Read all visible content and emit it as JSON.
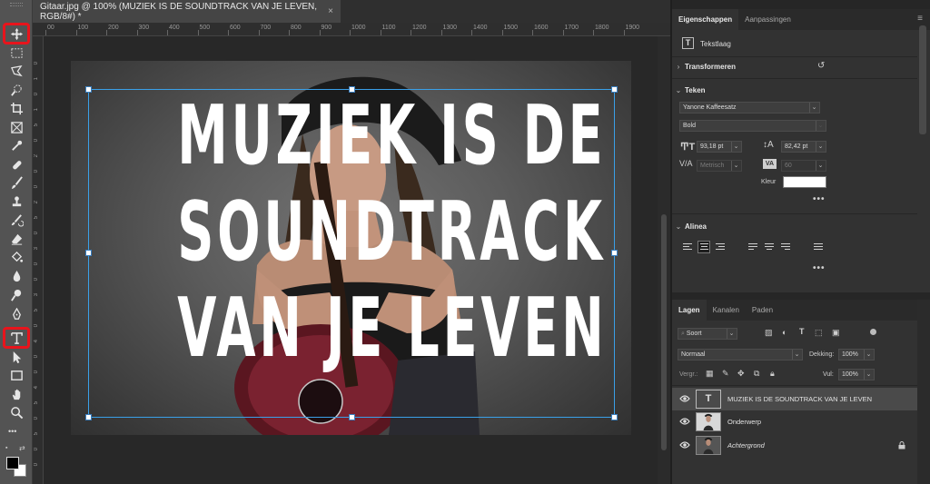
{
  "document": {
    "tab_title": "Gitaar.jpg @ 100% (MUZIEK IS DE SOUNDTRACK VAN JE LEVEN, RGB/8#) *",
    "close_glyph": "×",
    "ruler_top": [
      "00",
      "100",
      "200",
      "300",
      "400",
      "500",
      "600",
      "700",
      "800",
      "900",
      "1000",
      "1100",
      "1200",
      "1300",
      "1400",
      "1500",
      "1600",
      "1700",
      "1800",
      "1900"
    ],
    "ruler_left": [
      "0",
      "1",
      "0",
      "1",
      "5",
      "0",
      "2",
      "0",
      "0",
      "2",
      "5",
      "0",
      "3",
      "0",
      "0",
      "3",
      "5",
      "0",
      "4",
      "0",
      "0",
      "4",
      "5",
      "0",
      "5",
      "0",
      "0"
    ]
  },
  "text_layer": {
    "lines": [
      "MUZIEK IS DE",
      "SOUNDTRACK",
      "VAN JE LEVEN"
    ]
  },
  "toolbar": {
    "tools": [
      "move-tool",
      "marquee-tool",
      "lasso-tool",
      "quick-selection-tool",
      "crop-tool",
      "frame-tool",
      "eyedropper-tool",
      "healing-brush-tool",
      "brush-tool",
      "clone-stamp-tool",
      "history-brush-tool",
      "eraser-tool",
      "paint-bucket-tool",
      "blur-tool",
      "dodge-tool",
      "pen-tool",
      "type-tool",
      "path-selection-tool",
      "rectangle-tool",
      "hand-tool",
      "zoom-tool"
    ],
    "more_glyph": "•••",
    "foreground_color": "#000000",
    "background_color": "#ffffff"
  },
  "properties": {
    "tabs": [
      "Eigenschappen",
      "Aanpassingen"
    ],
    "menu_glyph": "≡",
    "layer_kind": "Tekstlaag",
    "transform_header": "Transformeren",
    "reset_glyph": "↺",
    "character_header": "Teken",
    "font_family": "Yanone Kaffeesatz",
    "font_style": "Bold",
    "font_size": "93,18 pt",
    "leading": "82,42 pt",
    "kerning": "Metrisch",
    "tracking": "60",
    "color_label": "Kleur",
    "text_color": "#ffffff",
    "more_glyph": "•••",
    "paragraph_header": "Alinea"
  },
  "layers": {
    "tabs": [
      "Lagen",
      "Kanalen",
      "Paden"
    ],
    "menu_glyph": "≡",
    "filter_kind": "Soort",
    "blend_mode": "Normaal",
    "opacity_label": "Dekking:",
    "opacity_value": "100%",
    "lock_label": "Vergr.:",
    "fill_label": "Vul:",
    "fill_value": "100%",
    "items": [
      {
        "name": "MUZIEK IS DE SOUNDTRACK VAN JE LEVEN",
        "kind": "text",
        "selected": true
      },
      {
        "name": "Onderwerp",
        "kind": "image",
        "selected": false
      },
      {
        "name": "Achtergrond",
        "kind": "image",
        "selected": false,
        "locked": true
      }
    ]
  },
  "colors": {
    "highlight": "#e8141c",
    "selection": "#3aa0e8"
  }
}
